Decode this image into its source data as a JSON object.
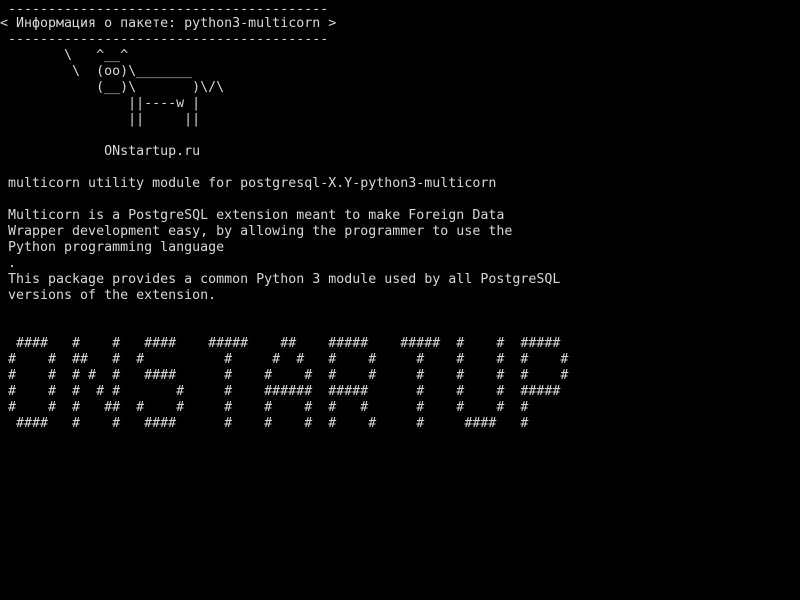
{
  "terminal": {
    "bubble_top": " ----------------------------------------",
    "bubble_text": "< Информация о пакете: python3-multicorn >",
    "bubble_bottom": " ----------------------------------------",
    "cow": [
      "        \\   ^__^",
      "         \\  (oo)\\_______",
      "            (__)\\       )\\/\\",
      "                ||----w |",
      "                ||     ||"
    ],
    "site": "             ONstartup.ru",
    "summary": " multicorn utility module for postgresql-X.Y-python3-multicorn",
    "description": [
      " Multicorn is a PostgreSQL extension meant to make Foreign Data",
      " Wrapper development easy, by allowing the programmer to use the",
      " Python programming language",
      " .",
      " This package provides a common Python 3 module used by all PostgreSQL",
      " versions of the extension."
    ],
    "banner": [
      "  ####   #    #   ####    #####    ##    #####    #####  #    #  #####",
      " #    #  ##   #  #          #     #  #   #    #     #    #    #  #    #",
      " #    #  # #  #   ####      #    #    #  #    #     #    #    #  #    #",
      " #    #  #  # #       #     #    ######  #####      #    #    #  #####",
      " #    #  #   ##  #    #     #    #    #  #   #      #    #    #  #",
      "  ####   #    #   ####      #    #    #  #    #     #     ####   #"
    ]
  }
}
